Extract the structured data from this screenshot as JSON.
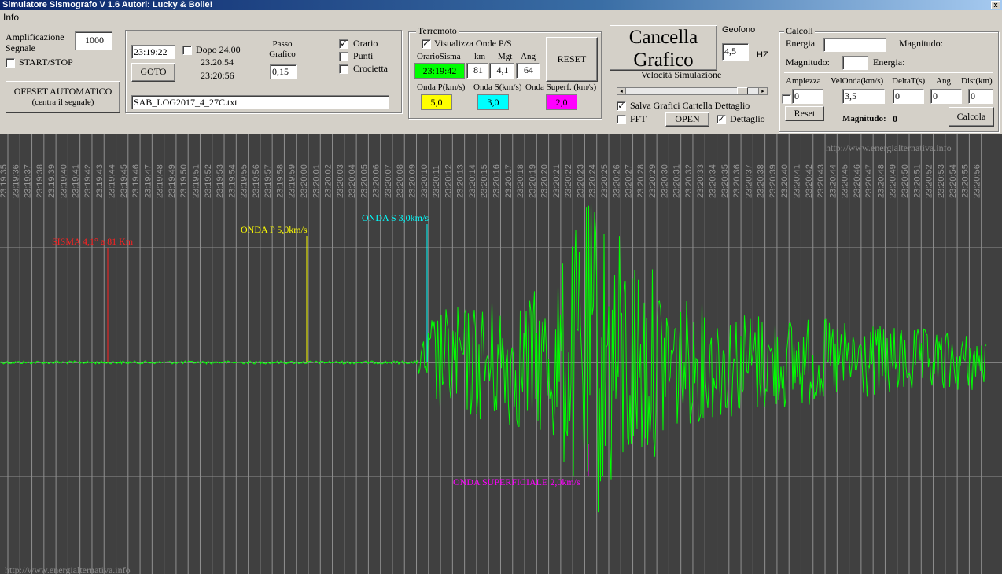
{
  "window": {
    "title": "Simulatore Sismografo V 1.6  Autori: Lucky & Bolle!",
    "close_label": "x"
  },
  "menu": {
    "items": [
      "Info"
    ]
  },
  "amplification": {
    "label": "Amplificazione Segnale",
    "value": "1000",
    "start_stop_label": "START/STOP",
    "start_stop_checked": false
  },
  "offset_button": {
    "line1": "OFFSET AUTOMATICO",
    "line2": "(centra il segnale)"
  },
  "time_panel": {
    "goto_time": "23:19:22",
    "dopo_label": "Dopo 24.00",
    "dopo_checked": false,
    "time1": "23.20.54",
    "time2": "23:20:56",
    "goto_label": "GOTO",
    "passo_label": "Passo Grafico",
    "passo_value": "0,15",
    "orario_label": "Orario",
    "orario_checked": true,
    "punti_label": "Punti",
    "punti_checked": false,
    "crocietta_label": "Crocietta",
    "crocietta_checked": false,
    "file_name": "SAB_LOG2017_4_27C.txt"
  },
  "terremoto": {
    "title": "Terremoto",
    "show_waves_label": "Visualizza Onde P/S",
    "show_waves_checked": true,
    "headers": {
      "orario": "OrarioSisma",
      "km": "km",
      "mgt": "Mgt",
      "ang": "Ang"
    },
    "orario_value": "23:19:42",
    "km_value": "81",
    "mgt_value": "4,1",
    "ang_value": "64",
    "reset_label": "RESET",
    "onda_p_label": "Onda P(km/s)",
    "onda_s_label": "Onda S(km/s)",
    "onda_sup_label": "Onda Superf. (km/s)",
    "onda_p_value": "5,0",
    "onda_s_value": "3,0",
    "onda_sup_value": "2,0",
    "colors": {
      "orario": "#00ff00",
      "p": "#ffff00",
      "s": "#00ffff",
      "sup": "#ff00ff"
    }
  },
  "cancella": {
    "line1": "Cancella",
    "line2": "Grafico"
  },
  "geofono": {
    "label": "Geofono",
    "value": "4,5",
    "unit": "HZ"
  },
  "velocita": {
    "label": "Velocità Simulazione",
    "level": 0.9
  },
  "salva": {
    "label": "Salva Grafici Cartella Dettaglio",
    "checked": true,
    "fft_label": "FFT",
    "fft_checked": false,
    "open_label": "OPEN",
    "dettaglio_label": "Dettaglio",
    "dettaglio_checked": true
  },
  "calcoli": {
    "title": "Calcoli",
    "energia_label": "Energia",
    "magnitudo_label": "Magnitudo:",
    "magnitudo2_label": "Magnitudo:",
    "energia2_label": "Energia:",
    "headers": {
      "ampiezza": "Ampiezza",
      "velonda": "VelOnda(km/s)",
      "deltat": "DeltaT(s)",
      "ang": "Ang.",
      "dist": "Dist(km)"
    },
    "ampiezza_value": "0",
    "velonda_value": "3,5",
    "deltat_value": "0",
    "ang_value": "0",
    "dist_value": "0",
    "reset_label": "Reset",
    "result_label": "Magnitudo:",
    "result_value": "0",
    "calcola_label": "Calcola"
  },
  "graph": {
    "watermark": "http://www.energialternativa.info",
    "watermark_bottom": "http://www.energialternativa.info",
    "time_labels": [
      "23:19:35",
      "23:19:36",
      "23:19:37",
      "23:19:38",
      "23:19:39",
      "23:19:40",
      "23:19:41",
      "23:19:42",
      "23:19:43",
      "23:19:44",
      "23:19:45",
      "23:19:46",
      "23:19:47",
      "23:19:48",
      "23:19:49",
      "23:19:50",
      "23:19:51",
      "23:19:52",
      "23:19:53",
      "23:19:54",
      "23:19:55",
      "23:19:56",
      "23:19:57",
      "23:19:58",
      "23:19:59",
      "23:20:00",
      "23:20:01",
      "23:20:02",
      "23:20:03",
      "23:20:04",
      "23:20:05",
      "23:20:06",
      "23:20:07",
      "23:20:08",
      "23:20:09",
      "23:20:10",
      "23:20:11",
      "23:20:12",
      "23:20:13",
      "23:20:14",
      "23:20:15",
      "23:20:16",
      "23:20:17",
      "23:20:18",
      "23:20:19",
      "23:20:20",
      "23:20:21",
      "23:20:22",
      "23:20:23",
      "23:20:24",
      "23:20:25",
      "23:20:26",
      "23:20:27",
      "23:20:28",
      "23:20:29",
      "23:20:30",
      "23:20:31",
      "23:20:32",
      "23:20:33",
      "23:20:34",
      "23:20:35",
      "23:20:36",
      "23:20:37",
      "23:20:38",
      "23:20:39",
      "23:20:40",
      "23:20:41",
      "23:20:42",
      "23:20:43",
      "23:20:44",
      "23:20:45",
      "23:20:46",
      "23:20:47",
      "23:20:48",
      "23:20:49",
      "23:20:50",
      "23:20:51",
      "23:20:52",
      "23:20:53",
      "23:20:54",
      "23:20:55",
      "23:20:56"
    ],
    "markers": [
      {
        "label": "SISMA 4,1° a 81 Km",
        "color": "#ff2020"
      },
      {
        "label": "ONDA P 5,0km/s",
        "color": "#ffff00"
      },
      {
        "label": "ONDA S 3,0km/s",
        "color": "#00ffff"
      },
      {
        "label": "ONDA SUPERFICIALE 2,0km/s",
        "color": "#ff00ff"
      }
    ],
    "signal_color": "#00ff00",
    "grid_color": "#909090",
    "background": "#404040"
  }
}
